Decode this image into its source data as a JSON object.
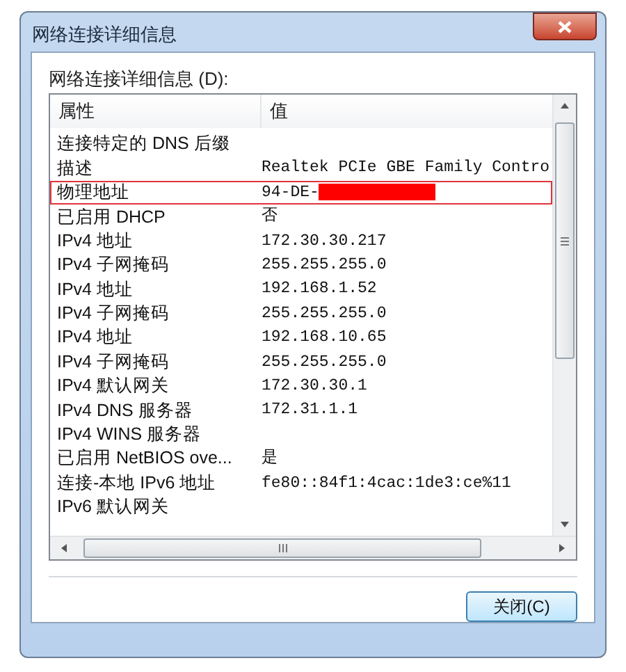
{
  "window": {
    "title": "网络连接详细信息"
  },
  "list_label": "网络连接详细信息 (D):",
  "table": {
    "columns": [
      "属性",
      "值"
    ],
    "rows": [
      {
        "property": "连接特定的 DNS 后缀",
        "value": "",
        "highlighted": false,
        "redacted": false
      },
      {
        "property": "描述",
        "value": "Realtek PCIe GBE Family Contro",
        "highlighted": false,
        "redacted": false
      },
      {
        "property": "物理地址",
        "value": "94-DE-",
        "highlighted": true,
        "redacted": true
      },
      {
        "property": "已启用 DHCP",
        "value": "否",
        "highlighted": false,
        "redacted": false
      },
      {
        "property": "IPv4 地址",
        "value": "172.30.30.217",
        "highlighted": false,
        "redacted": false
      },
      {
        "property": "IPv4 子网掩码",
        "value": "255.255.255.0",
        "highlighted": false,
        "redacted": false
      },
      {
        "property": "IPv4 地址",
        "value": "192.168.1.52",
        "highlighted": false,
        "redacted": false
      },
      {
        "property": "IPv4 子网掩码",
        "value": "255.255.255.0",
        "highlighted": false,
        "redacted": false
      },
      {
        "property": "IPv4 地址",
        "value": "192.168.10.65",
        "highlighted": false,
        "redacted": false
      },
      {
        "property": "IPv4 子网掩码",
        "value": "255.255.255.0",
        "highlighted": false,
        "redacted": false
      },
      {
        "property": "IPv4 默认网关",
        "value": "172.30.30.1",
        "highlighted": false,
        "redacted": false
      },
      {
        "property": "IPv4 DNS 服务器",
        "value": "172.31.1.1",
        "highlighted": false,
        "redacted": false
      },
      {
        "property": "IPv4 WINS 服务器",
        "value": "",
        "highlighted": false,
        "redacted": false
      },
      {
        "property": "已启用 NetBIOS ove...",
        "value": "是",
        "highlighted": false,
        "redacted": false
      },
      {
        "property": "连接-本地 IPv6 地址",
        "value": "fe80::84f1:4cac:1de3:ce%11",
        "highlighted": false,
        "redacted": false
      },
      {
        "property": "IPv6 默认网关",
        "value": "",
        "highlighted": false,
        "redacted": false
      }
    ]
  },
  "buttons": [
    "关闭(C)"
  ]
}
